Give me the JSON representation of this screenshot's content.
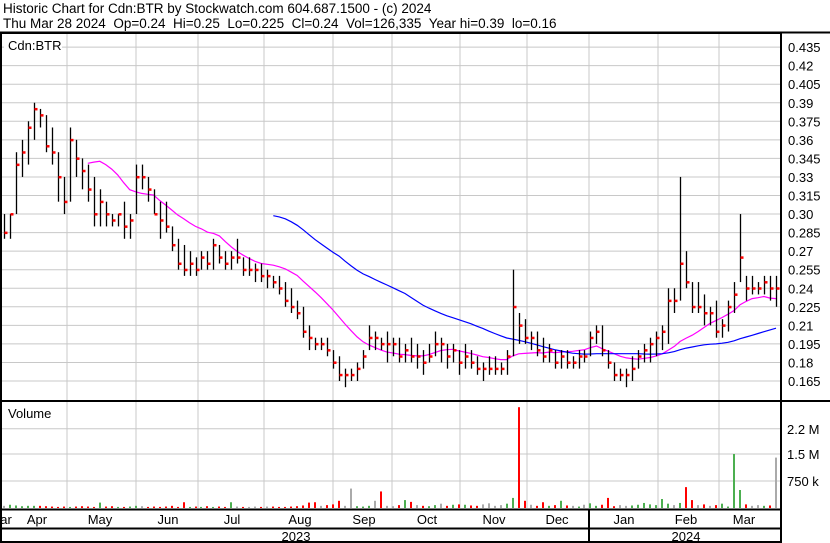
{
  "header": {
    "title": "Historic Chart for Cdn:BTR by Stockwatch.com 604.687.1500 - (c) 2024",
    "quote": "Thu Mar 28 2024  Op=0.24  Hi=0.25  Lo=0.225  Cl=0.24  Vol=126,335  Year hi=0.39  lo=0.16"
  },
  "colors": {
    "bar": "#000000",
    "close_tick": "#ff0000",
    "ma_short": "#ff00ff",
    "ma_long": "#0000ff",
    "vol_up": "#4caf50",
    "vol_down": "#ff0000",
    "vol_flat": "#aaaaaa",
    "grid": "#c8c8c8"
  },
  "chart_data": [
    {
      "type": "ohlc",
      "title": "Cdn:BTR",
      "ylim": [
        0.1575,
        0.4425
      ],
      "y_ticks": [
        "0.435",
        "0.42",
        "0.405",
        "0.39",
        "0.375",
        "0.36",
        "0.345",
        "0.33",
        "0.315",
        "0.30",
        "0.285",
        "0.27",
        "0.255",
        "0.24",
        "0.225",
        "0.21",
        "0.195",
        "0.18",
        "0.165"
      ],
      "moving_averages": [
        {
          "name": "short",
          "period": 15,
          "color": "#ff00ff"
        },
        {
          "name": "long",
          "period": 46,
          "color": "#0000ff"
        }
      ],
      "bars_hlc": [
        [
          0.3,
          0.28,
          0.285
        ],
        [
          0.3,
          0.28,
          0.3
        ],
        [
          0.35,
          0.3,
          0.34
        ],
        [
          0.36,
          0.33,
          0.35
        ],
        [
          0.375,
          0.34,
          0.37
        ],
        [
          0.39,
          0.36,
          0.385
        ],
        [
          0.385,
          0.37,
          0.38
        ],
        [
          0.38,
          0.35,
          0.355
        ],
        [
          0.37,
          0.34,
          0.35
        ],
        [
          0.35,
          0.31,
          0.33
        ],
        [
          0.33,
          0.3,
          0.31
        ],
        [
          0.37,
          0.31,
          0.36
        ],
        [
          0.36,
          0.33,
          0.345
        ],
        [
          0.345,
          0.32,
          0.335
        ],
        [
          0.34,
          0.31,
          0.32
        ],
        [
          0.33,
          0.29,
          0.3
        ],
        [
          0.32,
          0.29,
          0.31
        ],
        [
          0.31,
          0.29,
          0.3
        ],
        [
          0.3,
          0.29,
          0.295
        ],
        [
          0.3,
          0.29,
          0.3
        ],
        [
          0.31,
          0.28,
          0.29
        ],
        [
          0.3,
          0.28,
          0.295
        ],
        [
          0.34,
          0.3,
          0.33
        ],
        [
          0.34,
          0.32,
          0.33
        ],
        [
          0.33,
          0.31,
          0.32
        ],
        [
          0.32,
          0.3,
          0.3
        ],
        [
          0.31,
          0.28,
          0.295
        ],
        [
          0.31,
          0.285,
          0.29
        ],
        [
          0.29,
          0.27,
          0.275
        ],
        [
          0.28,
          0.255,
          0.26
        ],
        [
          0.275,
          0.25,
          0.255
        ],
        [
          0.27,
          0.25,
          0.26
        ],
        [
          0.265,
          0.25,
          0.255
        ],
        [
          0.27,
          0.255,
          0.265
        ],
        [
          0.27,
          0.255,
          0.26
        ],
        [
          0.28,
          0.255,
          0.275
        ],
        [
          0.275,
          0.26,
          0.265
        ],
        [
          0.27,
          0.255,
          0.26
        ],
        [
          0.27,
          0.255,
          0.265
        ],
        [
          0.28,
          0.26,
          0.265
        ],
        [
          0.265,
          0.25,
          0.255
        ],
        [
          0.265,
          0.25,
          0.255
        ],
        [
          0.26,
          0.245,
          0.255
        ],
        [
          0.26,
          0.245,
          0.25
        ],
        [
          0.255,
          0.24,
          0.25
        ],
        [
          0.25,
          0.24,
          0.245
        ],
        [
          0.25,
          0.235,
          0.24
        ],
        [
          0.245,
          0.225,
          0.23
        ],
        [
          0.24,
          0.22,
          0.225
        ],
        [
          0.23,
          0.215,
          0.22
        ],
        [
          0.225,
          0.2,
          0.205
        ],
        [
          0.21,
          0.19,
          0.2
        ],
        [
          0.2,
          0.19,
          0.195
        ],
        [
          0.2,
          0.19,
          0.195
        ],
        [
          0.2,
          0.185,
          0.19
        ],
        [
          0.19,
          0.175,
          0.18
        ],
        [
          0.185,
          0.165,
          0.17
        ],
        [
          0.175,
          0.16,
          0.17
        ],
        [
          0.175,
          0.165,
          0.17
        ],
        [
          0.18,
          0.165,
          0.175
        ],
        [
          0.19,
          0.175,
          0.185
        ],
        [
          0.21,
          0.19,
          0.2
        ],
        [
          0.205,
          0.19,
          0.2
        ],
        [
          0.2,
          0.19,
          0.195
        ],
        [
          0.205,
          0.18,
          0.195
        ],
        [
          0.2,
          0.185,
          0.195
        ],
        [
          0.2,
          0.18,
          0.185
        ],
        [
          0.195,
          0.18,
          0.19
        ],
        [
          0.2,
          0.18,
          0.185
        ],
        [
          0.195,
          0.175,
          0.185
        ],
        [
          0.19,
          0.17,
          0.18
        ],
        [
          0.195,
          0.18,
          0.185
        ],
        [
          0.205,
          0.185,
          0.195
        ],
        [
          0.2,
          0.18,
          0.195
        ],
        [
          0.195,
          0.175,
          0.185
        ],
        [
          0.195,
          0.18,
          0.19
        ],
        [
          0.19,
          0.17,
          0.18
        ],
        [
          0.195,
          0.175,
          0.185
        ],
        [
          0.19,
          0.175,
          0.18
        ],
        [
          0.185,
          0.17,
          0.175
        ],
        [
          0.18,
          0.165,
          0.175
        ],
        [
          0.185,
          0.17,
          0.175
        ],
        [
          0.185,
          0.17,
          0.175
        ],
        [
          0.18,
          0.17,
          0.175
        ],
        [
          0.19,
          0.17,
          0.185
        ],
        [
          0.255,
          0.185,
          0.225
        ],
        [
          0.22,
          0.195,
          0.21
        ],
        [
          0.215,
          0.195,
          0.2
        ],
        [
          0.205,
          0.19,
          0.2
        ],
        [
          0.205,
          0.185,
          0.19
        ],
        [
          0.2,
          0.18,
          0.185
        ],
        [
          0.195,
          0.18,
          0.19
        ],
        [
          0.19,
          0.175,
          0.18
        ],
        [
          0.19,
          0.175,
          0.185
        ],
        [
          0.19,
          0.175,
          0.18
        ],
        [
          0.185,
          0.175,
          0.18
        ],
        [
          0.19,
          0.175,
          0.185
        ],
        [
          0.19,
          0.18,
          0.185
        ],
        [
          0.205,
          0.185,
          0.2
        ],
        [
          0.21,
          0.195,
          0.205
        ],
        [
          0.21,
          0.185,
          0.19
        ],
        [
          0.19,
          0.175,
          0.18
        ],
        [
          0.18,
          0.165,
          0.17
        ],
        [
          0.175,
          0.165,
          0.17
        ],
        [
          0.175,
          0.16,
          0.17
        ],
        [
          0.185,
          0.165,
          0.175
        ],
        [
          0.19,
          0.175,
          0.185
        ],
        [
          0.195,
          0.18,
          0.19
        ],
        [
          0.2,
          0.18,
          0.195
        ],
        [
          0.205,
          0.185,
          0.2
        ],
        [
          0.21,
          0.19,
          0.205
        ],
        [
          0.24,
          0.195,
          0.23
        ],
        [
          0.24,
          0.22,
          0.23
        ],
        [
          0.33,
          0.23,
          0.26
        ],
        [
          0.27,
          0.24,
          0.245
        ],
        [
          0.245,
          0.22,
          0.225
        ],
        [
          0.245,
          0.22,
          0.225
        ],
        [
          0.235,
          0.21,
          0.22
        ],
        [
          0.225,
          0.21,
          0.22
        ],
        [
          0.23,
          0.2,
          0.205
        ],
        [
          0.215,
          0.2,
          0.21
        ],
        [
          0.23,
          0.205,
          0.225
        ],
        [
          0.245,
          0.22,
          0.235
        ],
        [
          0.3,
          0.245,
          0.265
        ],
        [
          0.25,
          0.23,
          0.24
        ],
        [
          0.25,
          0.235,
          0.24
        ],
        [
          0.245,
          0.235,
          0.24
        ],
        [
          0.25,
          0.235,
          0.245
        ],
        [
          0.25,
          0.23,
          0.24
        ],
        [
          0.25,
          0.225,
          0.24
        ]
      ]
    },
    {
      "type": "bar",
      "title": "Volume",
      "ylim": [
        0,
        3000000
      ],
      "y_ticks": [
        {
          "label": "2.2 M",
          "value": 2200000
        },
        {
          "label": "1.5 M",
          "value": 1500000
        },
        {
          "label": "750 k",
          "value": 750000
        }
      ],
      "values_thousands": [
        60,
        90,
        70,
        50,
        60,
        60,
        60,
        50,
        40,
        30,
        40,
        30,
        40,
        50,
        40,
        30,
        150,
        40,
        50,
        30,
        30,
        40,
        60,
        50,
        30,
        40,
        30,
        40,
        60,
        30,
        160,
        30,
        40,
        30,
        50,
        30,
        40,
        30,
        160,
        40,
        30,
        30,
        40,
        30,
        40,
        40,
        30,
        30,
        40,
        50,
        70,
        150,
        160,
        60,
        80,
        100,
        200,
        60,
        540,
        50,
        40,
        60,
        200,
        460,
        60,
        50,
        80,
        220,
        170,
        80,
        60,
        50,
        80,
        120,
        60,
        90,
        100,
        90,
        70,
        60,
        100,
        130,
        60,
        80,
        120,
        280,
        2800,
        200,
        90,
        60,
        160,
        60,
        80,
        200,
        70,
        60,
        40,
        90,
        130,
        60,
        90,
        280,
        50,
        80,
        60,
        70,
        90,
        140,
        100,
        80,
        250,
        120,
        80,
        140,
        580,
        220,
        80,
        100,
        60,
        80,
        120,
        40,
        1500,
        500,
        100,
        60,
        80,
        60,
        70,
        1400
      ]
    }
  ],
  "x_axis": {
    "months": [
      "ar",
      "Apr",
      "May",
      "Jun",
      "Jul",
      "Aug",
      "Sep",
      "Oct",
      "Nov",
      "Dec",
      "Jan",
      "Feb",
      "Mar"
    ],
    "years": [
      "2023",
      "2024"
    ]
  }
}
